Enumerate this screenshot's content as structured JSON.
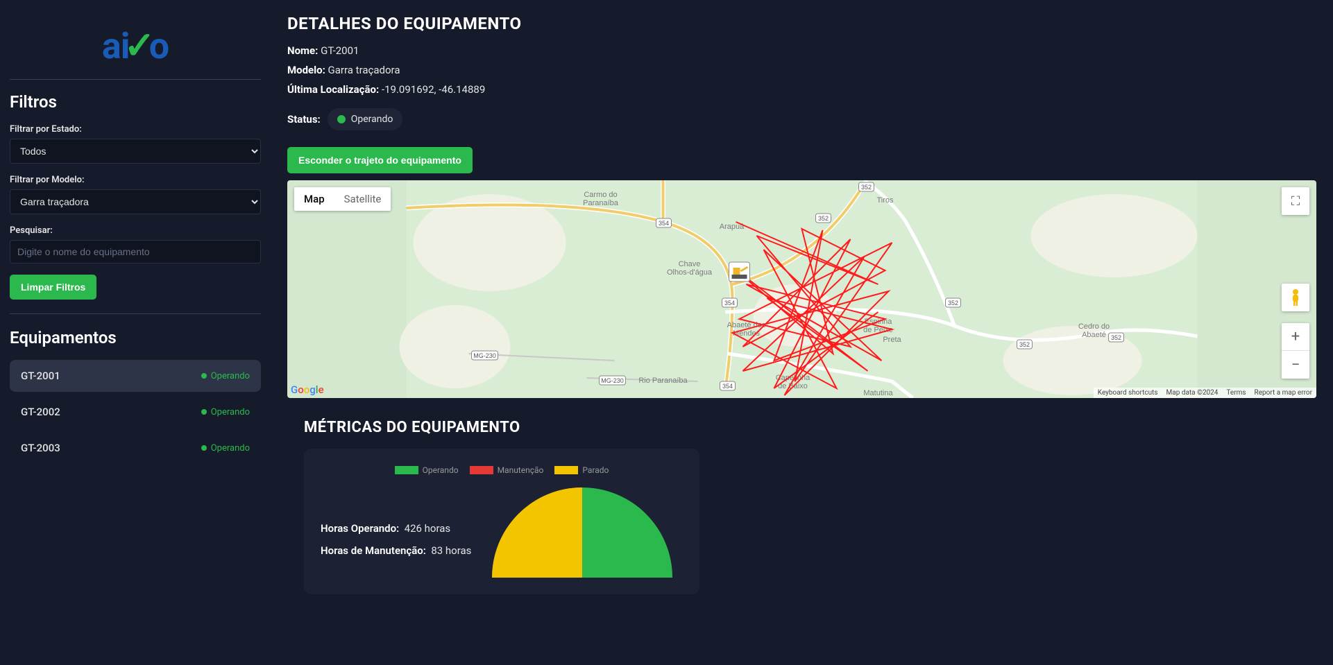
{
  "sidebar": {
    "filters_title": "Filtros",
    "filter_state_label": "Filtrar por Estado:",
    "filter_state_value": "Todos",
    "filter_model_label": "Filtrar por Modelo:",
    "filter_model_value": "Garra traçadora",
    "search_label": "Pesquisar:",
    "search_placeholder": "Digite o nome do equipamento",
    "clear_button": "Limpar Filtros",
    "equipments_title": "Equipamentos",
    "equipments": [
      {
        "name": "GT-2001",
        "status": "Operando",
        "active": true
      },
      {
        "name": "GT-2002",
        "status": "Operando",
        "active": false
      },
      {
        "name": "GT-2003",
        "status": "Operando",
        "active": false
      }
    ]
  },
  "details": {
    "title": "DETALHES DO EQUIPAMENTO",
    "name_label": "Nome:",
    "name_value": "GT-2001",
    "model_label": "Modelo:",
    "model_value": "Garra traçadora",
    "location_label": "Última Localização:",
    "location_value": "-19.091692, -46.14889",
    "status_label": "Status:",
    "status_value": "Operando",
    "status_color": "#2bb84c",
    "toggle_button": "Esconder o trajeto do equipamento"
  },
  "map": {
    "tab_map": "Map",
    "tab_satellite": "Satellite",
    "footer_shortcuts": "Keyboard shortcuts",
    "footer_data": "Map data ©2024",
    "footer_terms": "Terms",
    "footer_report": "Report a map error",
    "places": [
      "Carmo do Paranaíba",
      "Arapuá",
      "Tiros",
      "Chave Olhos-d'água",
      "Abaeté dos Mendes",
      "Espinha de Peixe",
      "Preta",
      "Cedro do Abaeté",
      "Matutina",
      "Rio Paranaíba",
      "Capelinha de Baixo"
    ],
    "roads": [
      "352",
      "354",
      "354",
      "352",
      "354",
      "MG-230",
      "MG-230",
      "354",
      "352",
      "352"
    ]
  },
  "metrics": {
    "title": "MÉTRICAS DO EQUIPAMENTO",
    "legend": [
      {
        "label": "Operando",
        "color": "#2bb84c"
      },
      {
        "label": "Manutenção",
        "color": "#e53935"
      },
      {
        "label": "Parado",
        "color": "#f2c500"
      }
    ],
    "hours_operating_label": "Horas Operando:",
    "hours_operating_value": "426 horas",
    "hours_maintenance_label": "Horas de Manutenção:",
    "hours_maintenance_value": "83 horas"
  },
  "chart_data": {
    "type": "pie",
    "title": "Métricas do Equipamento",
    "series": [
      {
        "name": "Operando",
        "value": 426,
        "color": "#2bb84c"
      },
      {
        "name": "Manutenção",
        "value": 83,
        "color": "#e53935"
      },
      {
        "name": "Parado",
        "value": 340,
        "color": "#f2c500"
      }
    ]
  }
}
